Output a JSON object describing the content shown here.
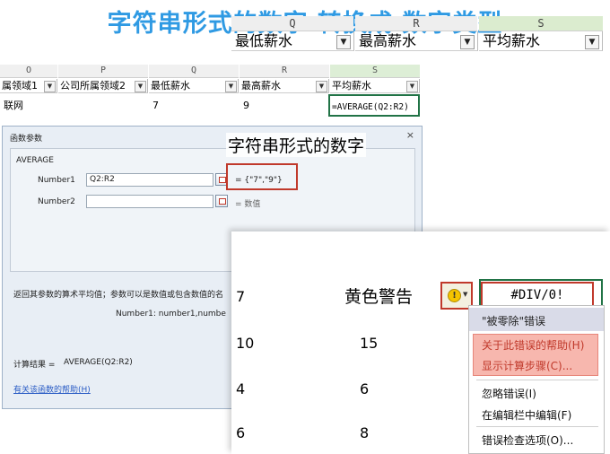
{
  "title": "字符串形式的数字 转换成 数字类型",
  "sheet": {
    "columns": [
      "O",
      "P",
      "Q",
      "R",
      "S"
    ],
    "headers": [
      "属领域1",
      "公司所属领域2",
      "最低薪水",
      "最高薪水",
      "平均薪水"
    ],
    "row": [
      "联网",
      "",
      "7",
      "9",
      "=AVERAGE(Q2:R2)"
    ]
  },
  "dialog": {
    "title": "函数参数",
    "close": "×",
    "function_name": "AVERAGE",
    "number1_label": "Number1",
    "number1_value": "Q2:R2",
    "number1_result": "= {\"7\",\"9\"}",
    "number2_label": "Number2",
    "number2_result": "= 数值",
    "description": "返回其参数的算术平均值；参数可以是数值或包含数值的名",
    "param_help": "Number1:  number1,numbe",
    "result_label": "计算结果 =",
    "result_value": "AVERAGE(Q2:R2)",
    "help_link": "有关该函数的帮助(H)"
  },
  "annotations": {
    "string_numbers": "字符串形式的数字",
    "yellow_warning": "黄色警告"
  },
  "inset": {
    "columns": [
      "Q",
      "R",
      "S"
    ],
    "headers": [
      "最低薪水",
      "最高薪水",
      "平均薪水"
    ],
    "rows": [
      [
        "7",
        "",
        "#DIV/0!"
      ],
      [
        "10",
        "15",
        ""
      ],
      [
        "4",
        "6",
        ""
      ],
      [
        "6",
        "8",
        ""
      ]
    ],
    "warn_symbol": "!"
  },
  "error_menu": {
    "items": [
      "\"被零除\"错误",
      "关于此错误的帮助(H)",
      "显示计算步骤(C)...",
      "忽略错误(I)",
      "在编辑栏中编辑(F)",
      "错误检查选项(O)..."
    ]
  },
  "colors": {
    "title": "#2f9ae3",
    "highlight_red": "#c0392b",
    "menu_highlight": "#f7b7ae",
    "menu_header_bg": "#d9dbe8",
    "warning_yellow": "#f5c400"
  }
}
